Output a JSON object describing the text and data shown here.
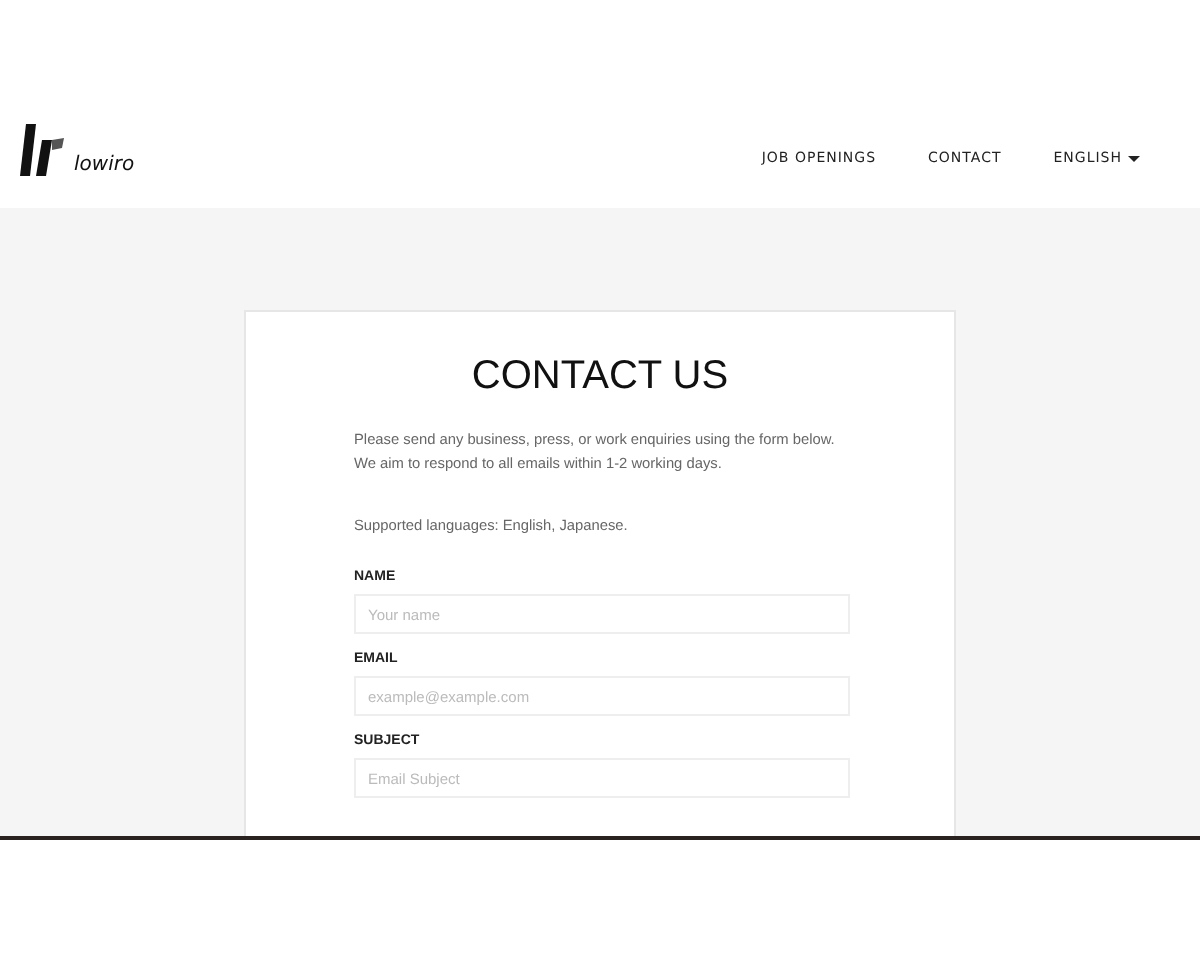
{
  "header": {
    "logo_text": "lowiro",
    "nav": [
      {
        "label": "JOB OPENINGS",
        "kind": "link"
      },
      {
        "label": "CONTACT",
        "kind": "link"
      },
      {
        "label": "ENGLISH",
        "kind": "dropdown"
      }
    ]
  },
  "card": {
    "title": "CONTACT US",
    "intro": [
      "Please send any business, press, or work enquiries using the form below.",
      "We aim to respond to all emails within 1-2 working days."
    ],
    "languages": "Supported languages: English, Japanese.",
    "fields": [
      {
        "label": "NAME",
        "placeholder": "Your name"
      },
      {
        "label": "EMAIL",
        "placeholder": "example@example.com"
      },
      {
        "label": "SUBJECT",
        "placeholder": "Email Subject"
      }
    ]
  }
}
